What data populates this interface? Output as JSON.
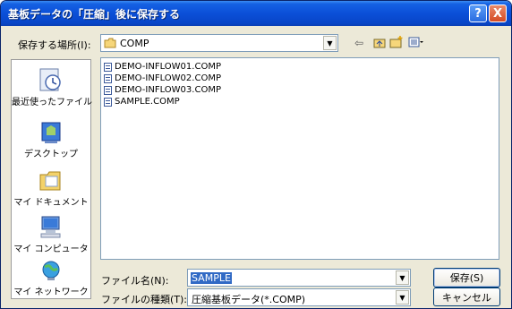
{
  "window": {
    "title": "基板データの「圧縮」後に保存する",
    "help_label": "?",
    "close_label": "X"
  },
  "location": {
    "label": "保存する場所(I):",
    "value": "COMP"
  },
  "toolbar": {
    "icons": [
      "back-icon",
      "up-folder-icon",
      "new-folder-icon",
      "view-menu-icon"
    ]
  },
  "places": [
    {
      "label": "最近使ったファイル",
      "icon": "recent-files-icon"
    },
    {
      "label": "デスクトップ",
      "icon": "desktop-icon"
    },
    {
      "label": "マイ ドキュメント",
      "icon": "my-documents-icon"
    },
    {
      "label": "マイ コンピュータ",
      "icon": "my-computer-icon"
    },
    {
      "label": "マイ ネットワーク",
      "icon": "my-network-icon"
    }
  ],
  "files": [
    "DEMO-INFLOW01.COMP",
    "DEMO-INFLOW02.COMP",
    "DEMO-INFLOW03.COMP",
    "SAMPLE.COMP"
  ],
  "filename": {
    "label": "ファイル名(N):",
    "value": "SAMPLE"
  },
  "filetype": {
    "label": "ファイルの種類(T):",
    "value": "圧縮基板データ(*.COMP)"
  },
  "buttons": {
    "save": "保存(S)",
    "cancel": "キャンセル"
  }
}
